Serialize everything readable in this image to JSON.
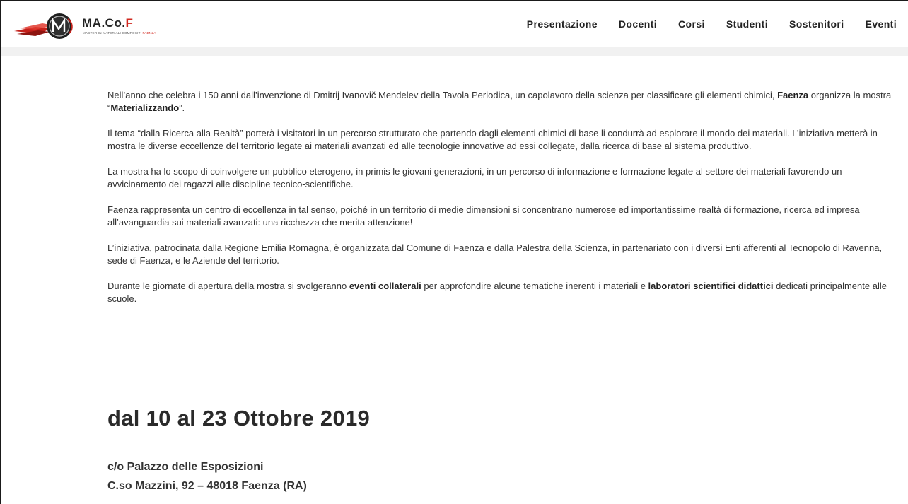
{
  "brand": {
    "name_part1": "MA.Co.",
    "name_part2": "F",
    "tagline_part1": "MASTER IN MATERIALI COMPOSITI ",
    "tagline_part2": "FAENZA",
    "accent_color": "#d0281f"
  },
  "nav": {
    "items": [
      "Presentazione",
      "Docenti",
      "Corsi",
      "Studenti",
      "Sostenitori",
      "Eventi"
    ]
  },
  "content": {
    "p1": {
      "text1": "Nell’anno che celebra i 150 anni dall’invenzione di Dmitrij Ivanovič Mendelev della Tavola Periodica, un capolavoro della scienza per classificare gli elementi chimici, ",
      "bold1": "Faenza",
      "text2": " organizza la mostra “",
      "bold2": "Materializzando",
      "text3": "”."
    },
    "p2": "Il tema “dalla Ricerca alla Realtà” porterà i visitatori in un percorso strutturato che partendo dagli elementi chimici di base li condurrà ad esplorare il mondo dei materiali. L’iniziativa metterà in mostra le diverse eccellenze del territorio legate ai materiali avanzati ed alle tecnologie innovative ad essi collegate, dalla ricerca di base al sistema produttivo.",
    "p3": "La mostra ha lo scopo di coinvolgere un pubblico eterogeno, in primis le giovani generazioni, in un percorso di informazione e formazione legate al settore dei materiali favorendo un avvicinamento dei ragazzi alle discipline tecnico-scientifiche.",
    "p4": "Faenza rappresenta un centro di eccellenza in tal senso, poiché in un territorio di medie dimensioni si concentrano numerose ed importantissime realtà di formazione, ricerca ed impresa all’avanguardia sui materiali avanzati: una ricchezza che merita attenzione!",
    "p5": "L’iniziativa, patrocinata dalla Regione Emilia Romagna,  è organizzata dal Comune di Faenza e dalla Palestra della Scienza, in partenariato con i diversi Enti afferenti al Tecnopolo di Ravenna, sede di Faenza, e le Aziende del territorio.",
    "p6": {
      "text1": "Durante le giornate di apertura della mostra si svolgeranno ",
      "bold1": "eventi collaterali",
      "text2": " per approfondire alcune tematiche inerenti i materiali e ",
      "bold2": "laboratori scientifici didattici",
      "text3": " dedicati principalmente alle scuole."
    }
  },
  "event": {
    "date_title": "dal 10 al 23 Ottobre 2019",
    "venue": "c/o Palazzo delle Esposizioni",
    "address": "C.so Mazzini, 92 – 48018 Faenza (RA)"
  }
}
